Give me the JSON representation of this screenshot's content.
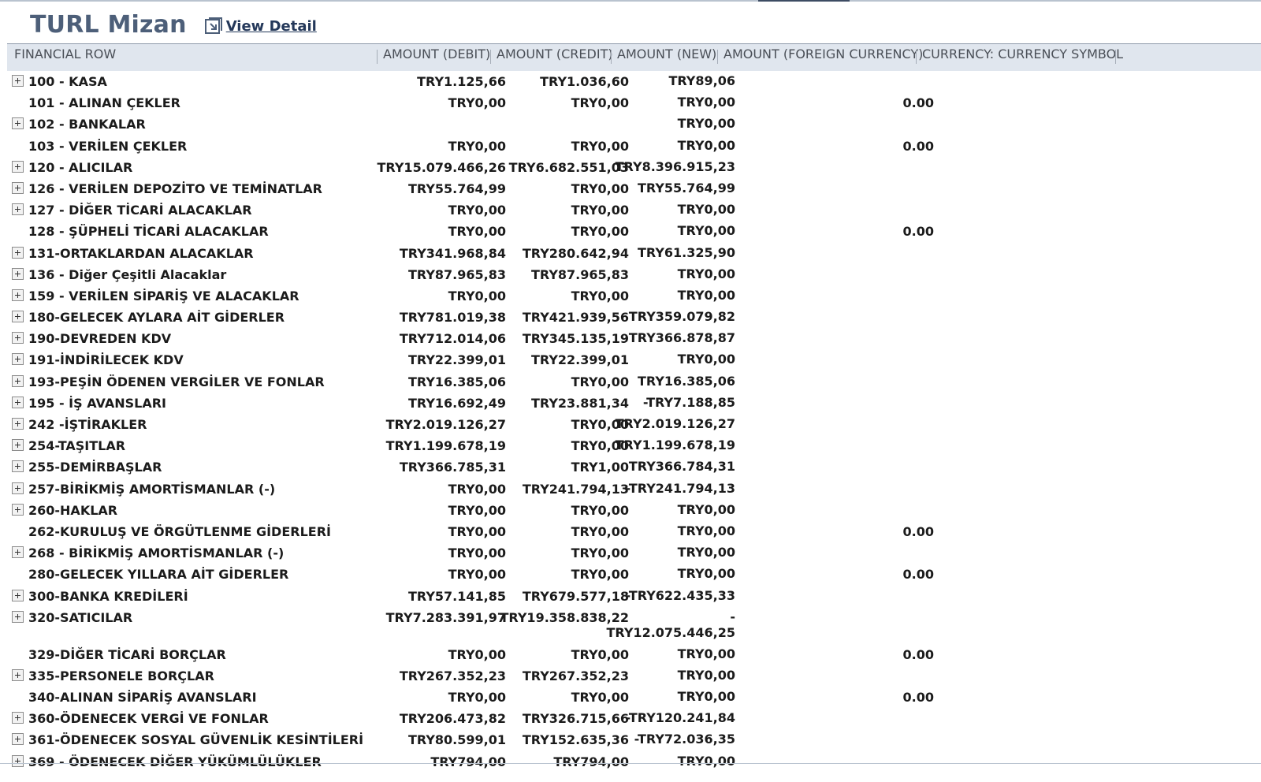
{
  "header": {
    "title": "TURL Mizan",
    "view_detail_label": "View Detail",
    "view_detail_icon": "external-link-icon"
  },
  "columns": {
    "financial_row": "FINANCIAL ROW",
    "debit": "AMOUNT (DEBIT)",
    "credit": "AMOUNT (CREDIT)",
    "new": "AMOUNT (NEW)",
    "foreign": "AMOUNT (FOREIGN CURRENCY)",
    "currency_symbol": "CURRENCY: CURRENCY SYMBOL"
  },
  "rows": [
    {
      "expandable": true,
      "name": "100 - KASA",
      "debit": "TRY1.125,66",
      "credit": "TRY1.036,60",
      "new": "TRY89,06",
      "foreign": ""
    },
    {
      "expandable": false,
      "name": "101 - ALINAN ÇEKLER",
      "debit": "TRY0,00",
      "credit": "TRY0,00",
      "new": "TRY0,00",
      "foreign": "0.00"
    },
    {
      "expandable": true,
      "name": "102 - BANKALAR",
      "debit": "",
      "credit": "",
      "new": "TRY0,00",
      "foreign": ""
    },
    {
      "expandable": false,
      "name": "103 - VERİLEN ÇEKLER",
      "debit": "TRY0,00",
      "credit": "TRY0,00",
      "new": "TRY0,00",
      "foreign": "0.00"
    },
    {
      "expandable": true,
      "name": "120 - ALICILAR",
      "debit": "TRY15.079.466,26",
      "credit": "TRY6.682.551,03",
      "new": "TRY8.396.915,23",
      "foreign": ""
    },
    {
      "expandable": true,
      "name": "126 - VERİLEN DEPOZİTO VE TEMİNATLAR",
      "debit": "TRY55.764,99",
      "credit": "TRY0,00",
      "new": "TRY55.764,99",
      "foreign": ""
    },
    {
      "expandable": true,
      "name": "127 - DİĞER TİCARİ ALACAKLAR",
      "debit": "TRY0,00",
      "credit": "TRY0,00",
      "new": "TRY0,00",
      "foreign": ""
    },
    {
      "expandable": false,
      "name": "128 - ŞÜPHELİ TİCARİ ALACAKLAR",
      "debit": "TRY0,00",
      "credit": "TRY0,00",
      "new": "TRY0,00",
      "foreign": "0.00"
    },
    {
      "expandable": true,
      "name": "131-ORTAKLARDAN ALACAKLAR",
      "debit": "TRY341.968,84",
      "credit": "TRY280.642,94",
      "new": "TRY61.325,90",
      "foreign": ""
    },
    {
      "expandable": true,
      "name": "136 - Diğer Çeşitli Alacaklar",
      "debit": "TRY87.965,83",
      "credit": "TRY87.965,83",
      "new": "TRY0,00",
      "foreign": ""
    },
    {
      "expandable": true,
      "name": "159 - VERİLEN SİPARİŞ VE ALACAKLAR",
      "debit": "TRY0,00",
      "credit": "TRY0,00",
      "new": "TRY0,00",
      "foreign": ""
    },
    {
      "expandable": true,
      "name": "180-GELECEK AYLARA AİT GİDERLER",
      "debit": "TRY781.019,38",
      "credit": "TRY421.939,56",
      "new": "TRY359.079,82",
      "foreign": ""
    },
    {
      "expandable": true,
      "name": "190-DEVREDEN KDV",
      "debit": "TRY712.014,06",
      "credit": "TRY345.135,19",
      "new": "TRY366.878,87",
      "foreign": ""
    },
    {
      "expandable": true,
      "name": "191-İNDİRİLECEK KDV",
      "debit": "TRY22.399,01",
      "credit": "TRY22.399,01",
      "new": "TRY0,00",
      "foreign": ""
    },
    {
      "expandable": true,
      "name": "193-PEŞİN ÖDENEN VERGİLER VE FONLAR",
      "debit": "TRY16.385,06",
      "credit": "TRY0,00",
      "new": "TRY16.385,06",
      "foreign": ""
    },
    {
      "expandable": true,
      "name": "195 - İŞ AVANSLARI",
      "debit": "TRY16.692,49",
      "credit": "TRY23.881,34",
      "new": "-TRY7.188,85",
      "foreign": ""
    },
    {
      "expandable": true,
      "name": "242 -İŞTİRAKLER",
      "debit": "TRY2.019.126,27",
      "credit": "TRY0,00",
      "new": "TRY2.019.126,27",
      "foreign": ""
    },
    {
      "expandable": true,
      "name": "254-TAŞITLAR",
      "debit": "TRY1.199.678,19",
      "credit": "TRY0,00",
      "new": "TRY1.199.678,19",
      "foreign": ""
    },
    {
      "expandable": true,
      "name": "255-DEMİRBAŞLAR",
      "debit": "TRY366.785,31",
      "credit": "TRY1,00",
      "new": "TRY366.784,31",
      "foreign": ""
    },
    {
      "expandable": true,
      "name": "257-BİRİKMİŞ AMORTİSMANLAR (-)",
      "debit": "TRY0,00",
      "credit": "TRY241.794,13",
      "new": "-TRY241.794,13",
      "foreign": ""
    },
    {
      "expandable": true,
      "name": "260-HAKLAR",
      "debit": "TRY0,00",
      "credit": "TRY0,00",
      "new": "TRY0,00",
      "foreign": ""
    },
    {
      "expandable": false,
      "name": "262-KURULUŞ VE ÖRGÜTLENME GİDERLERİ",
      "debit": "TRY0,00",
      "credit": "TRY0,00",
      "new": "TRY0,00",
      "foreign": "0.00"
    },
    {
      "expandable": true,
      "name": "268 - BİRİKMİŞ AMORTİSMANLAR (-)",
      "debit": "TRY0,00",
      "credit": "TRY0,00",
      "new": "TRY0,00",
      "foreign": ""
    },
    {
      "expandable": false,
      "name": "280-GELECEK YILLARA AİT GİDERLER",
      "debit": "TRY0,00",
      "credit": "TRY0,00",
      "new": "TRY0,00",
      "foreign": "0.00"
    },
    {
      "expandable": true,
      "name": "300-BANKA KREDİLERİ",
      "debit": "TRY57.141,85",
      "credit": "TRY679.577,18",
      "new": "-TRY622.435,33",
      "foreign": ""
    },
    {
      "expandable": true,
      "name": "320-SATICILAR",
      "debit": "TRY7.283.391,97",
      "credit": "TRY19.358.838,22",
      "new": "-\nTRY12.075.446,25",
      "foreign": "",
      "tall": true
    },
    {
      "expandable": false,
      "name": "329-DİĞER TİCARİ BORÇLAR",
      "debit": "TRY0,00",
      "credit": "TRY0,00",
      "new": "TRY0,00",
      "foreign": "0.00"
    },
    {
      "expandable": true,
      "name": "335-PERSONELE BORÇLAR",
      "debit": "TRY267.352,23",
      "credit": "TRY267.352,23",
      "new": "TRY0,00",
      "foreign": ""
    },
    {
      "expandable": false,
      "name": "340-ALINAN SİPARİŞ AVANSLARI",
      "debit": "TRY0,00",
      "credit": "TRY0,00",
      "new": "TRY0,00",
      "foreign": "0.00"
    },
    {
      "expandable": true,
      "name": "360-ÖDENECEK VERGİ VE FONLAR",
      "debit": "TRY206.473,82",
      "credit": "TRY326.715,66",
      "new": "-TRY120.241,84",
      "foreign": ""
    },
    {
      "expandable": true,
      "name": "361-ÖDENECEK SOSYAL GÜVENLİK KESİNTİLERİ",
      "debit": "TRY80.599,01",
      "credit": "TRY152.635,36",
      "new": "-TRY72.036,35",
      "foreign": ""
    },
    {
      "expandable": true,
      "name": "369 - ÖDENECEK DİĞER YÜKÜMLÜLÜKLER",
      "debit": "TRY794,00",
      "credit": "TRY794,00",
      "new": "TRY0,00",
      "foreign": ""
    }
  ]
}
